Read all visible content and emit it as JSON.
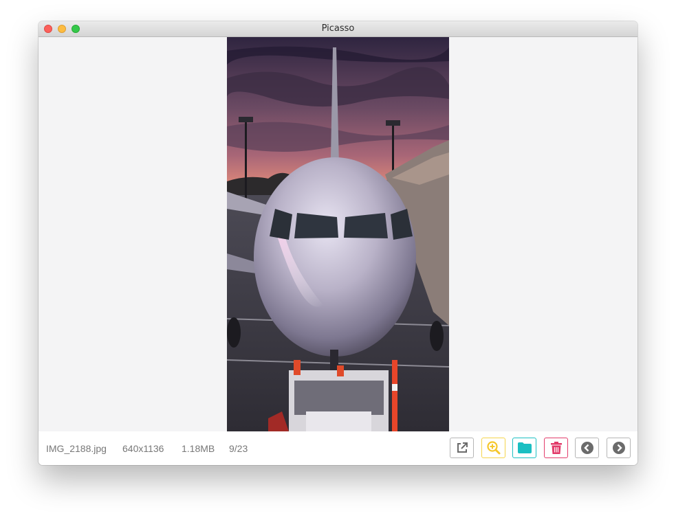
{
  "window": {
    "title": "Picasso"
  },
  "image": {
    "description_icon": "airplane-photo"
  },
  "status": {
    "filename": "IMG_2188.jpg",
    "resolution": "640x1136",
    "size": "1.18MB",
    "position": "9/23"
  },
  "toolbar": {
    "icons": [
      "external-link-icon",
      "zoom-in-icon",
      "folder-icon",
      "trash-icon",
      "chevron-left-icon",
      "chevron-right-icon"
    ],
    "colors": {
      "neutral": "#6b6b6b",
      "zoom": "#f5d54b",
      "folder": "#1bbfc2",
      "trash": "#e23b6a"
    }
  }
}
